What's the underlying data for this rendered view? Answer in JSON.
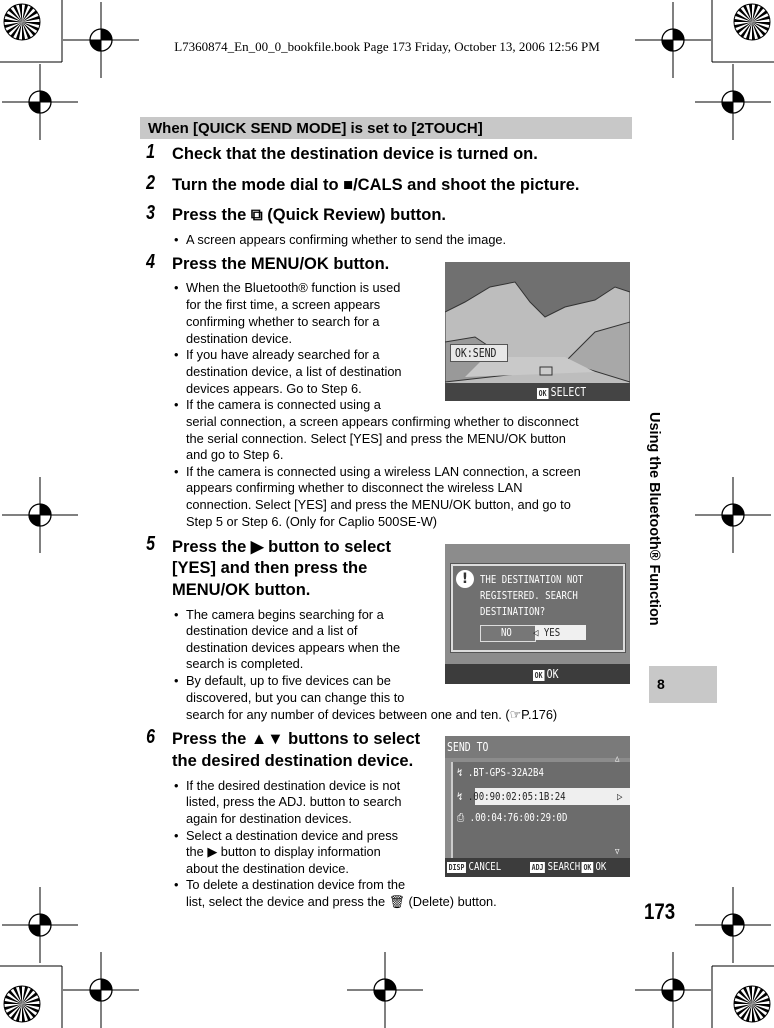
{
  "file_header": "L7360874_En_00_0_bookfile.book  Page 173  Friday, October 13, 2006  12:56 PM",
  "section_title": "When [QUICK SEND MODE] is set to [2TOUCH]",
  "steps": [
    {
      "num": "1",
      "title": [
        "Check that the destination device is turned on."
      ],
      "bullets": []
    },
    {
      "num": "2",
      "title": [
        "Turn the mode dial to ■/CALS and shoot the picture."
      ],
      "bullets": []
    },
    {
      "num": "3",
      "title": [
        "Press the ⧉ (Quick Review) button."
      ],
      "bullets": [
        [
          "A screen appears confirming whether to send the image."
        ]
      ]
    },
    {
      "num": "4",
      "title": [
        "Press the MENU/OK button."
      ],
      "bullets": [
        [
          "When the Bluetooth® function is used",
          "for the first time, a screen appears",
          "confirming whether to search for a",
          "destination device."
        ],
        [
          "If you have already searched for a",
          "destination device, a list of destination",
          "devices appears. Go to Step 6."
        ],
        [
          "If the camera is connected using a",
          "serial connection, a screen appears confirming whether to disconnect",
          "the serial connection. Select [YES] and press the MENU/OK button",
          "and go to Step 6."
        ],
        [
          "If the camera is connected using a wireless LAN connection, a screen",
          "appears confirming whether to disconnect the wireless LAN",
          "connection. Select [YES] and press the MENU/OK button, and go to",
          "Step 5 or Step 6. (Only for Caplio 500SE-W)"
        ]
      ]
    },
    {
      "num": "5",
      "title": [
        "Press the ▶ button to select",
        "[YES] and then press the",
        "MENU/OK button."
      ],
      "bullets": [
        [
          "The camera begins searching for a",
          "destination device and a list of",
          "destination devices appears when the",
          "search is completed."
        ],
        [
          "By default, up to five devices can be",
          "discovered, but you can change this to",
          "search for any number of devices between one and ten. (☞P.176)"
        ]
      ]
    },
    {
      "num": "6",
      "title": [
        "Press the ▲▼ buttons to select",
        "the desired destination device."
      ],
      "bullets": [
        [
          "If the desired destination device is not",
          "listed, press the ADJ. button to search",
          "again for destination devices."
        ],
        [
          "Select a destination device and press",
          "the ▶ button to display information",
          "about the destination device."
        ],
        [
          "To delete a destination device from the",
          "list, select the device and press the 🗑 (Delete) button."
        ]
      ]
    }
  ],
  "screen1": {
    "send_label": "OK:SEND",
    "ok_icon": "OK",
    "select_label": "SELECT"
  },
  "screen2": {
    "message": [
      "THE DESTINATION NOT",
      "REGISTERED. SEARCH",
      "DESTINATION?"
    ],
    "no_label": "NO",
    "yes_label": "YES",
    "ok_icon": "OK",
    "ok_label": "OK"
  },
  "screen3": {
    "title": "SEND TO",
    "devices": [
      ".BT-GPS-32A2B4",
      ".00:90:02:05:1B:24",
      ".00:04:76:00:29:0D"
    ],
    "disp_icon": "DISP",
    "cancel_label": "CANCEL",
    "adj_icon": "ADJ",
    "search_label": "SEARCH",
    "ok_icon": "OK",
    "ok_label": "OK"
  },
  "side_tab": "Using the Bluetooth® Function",
  "chapter_number": "8",
  "page_number": "173"
}
